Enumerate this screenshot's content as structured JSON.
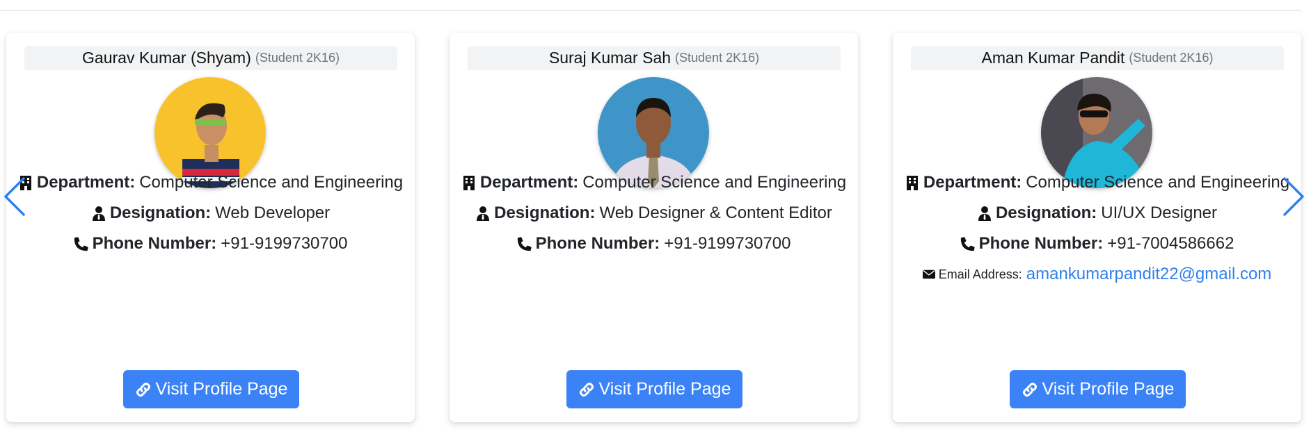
{
  "carousel": {
    "prev_icon": "chevron-left-icon",
    "next_icon": "chevron-right-icon",
    "arrow_color": "#2f80ed"
  },
  "labels": {
    "department": "Department:",
    "designation": "Designation:",
    "phone": "Phone Number:",
    "email": "Email Address:",
    "button": "Visit Profile Page"
  },
  "cards": [
    {
      "name": "Gaurav Kumar (Shyam)",
      "tag": "(Student 2K16)",
      "department": "Computer Science and Engineering",
      "designation": "Web Developer",
      "phone": "+91-9199730700"
    },
    {
      "name": "Suraj Kumar Sah",
      "tag": "(Student 2K16)",
      "department": "Computer Science and Engineering",
      "designation": "Web Designer & Content Editor",
      "phone": "+91-9199730700"
    },
    {
      "name": "Aman Kumar Pandit",
      "tag": "(Student 2K16)",
      "department": "Computer Science and Engineering",
      "designation": "UI/UX Designer",
      "phone": "+91-7004586662",
      "email": "amankumarpandit22@gmail.com"
    }
  ],
  "colors": {
    "button": "#3b82f6",
    "link": "#2f80ed"
  }
}
